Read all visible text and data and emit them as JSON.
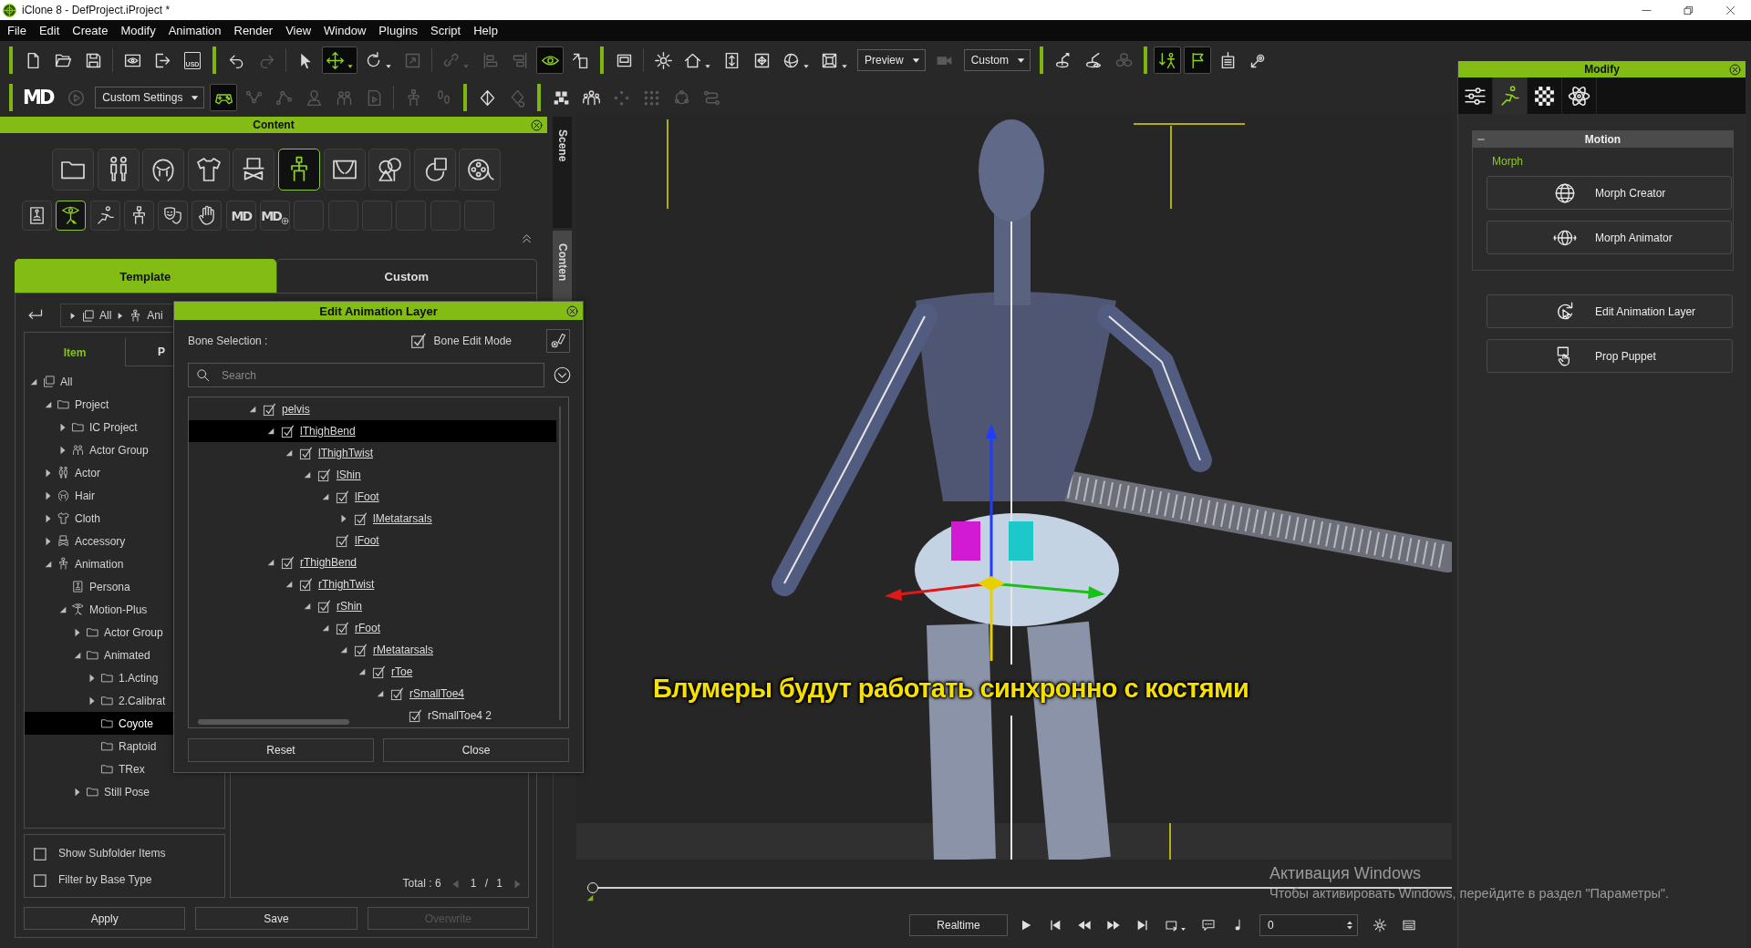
{
  "window": {
    "title": "iClone 8 - DefProject.iProject *"
  },
  "menu": [
    "File",
    "Edit",
    "Create",
    "Modify",
    "Animation",
    "Render",
    "View",
    "Window",
    "Plugins",
    "Script",
    "Help"
  ],
  "toolbar_main": [
    {
      "kind": "accent"
    },
    {
      "kind": "tool",
      "selected": false,
      "disabled": false
    },
    {
      "kind": "tool",
      "selected": false,
      "disabled": false
    },
    {
      "kind": "tool",
      "selected": false,
      "disabled": false
    },
    {
      "kind": "divider"
    },
    {
      "kind": "tool",
      "selected": false,
      "disabled": false
    },
    {
      "kind": "tool",
      "selected": false,
      "disabled": false
    },
    {
      "kind": "tool",
      "label": "USD",
      "selected": false,
      "disabled": false
    },
    {
      "kind": "accent"
    },
    {
      "kind": "tool",
      "selected": false,
      "disabled": false
    },
    {
      "kind": "tool",
      "selected": false,
      "disabled": true
    },
    {
      "kind": "divider"
    },
    {
      "kind": "tool",
      "selected": false,
      "disabled": false
    },
    {
      "kind": "split",
      "selected": true,
      "disabled": false
    },
    {
      "kind": "split",
      "selected": false,
      "disabled": false
    },
    {
      "kind": "tool",
      "selected": false,
      "disabled": true
    },
    {
      "kind": "divider"
    },
    {
      "kind": "split",
      "selected": false,
      "disabled": true
    },
    {
      "kind": "tool",
      "selected": false,
      "disabled": true
    },
    {
      "kind": "tool",
      "selected": false,
      "disabled": true
    },
    {
      "kind": "tool",
      "selected": true,
      "disabled": false
    },
    {
      "kind": "tool",
      "selected": false,
      "disabled": false
    },
    {
      "kind": "accent"
    },
    {
      "kind": "tool",
      "selected": false,
      "disabled": false
    },
    {
      "kind": "divider"
    },
    {
      "kind": "tool",
      "selected": false,
      "disabled": false
    },
    {
      "kind": "split",
      "selected": false,
      "disabled": false
    },
    {
      "kind": "tool",
      "selected": false,
      "disabled": false
    },
    {
      "kind": "tool",
      "selected": false,
      "disabled": false
    },
    {
      "kind": "split",
      "selected": false,
      "disabled": false
    },
    {
      "kind": "split",
      "selected": false,
      "disabled": false
    },
    {
      "kind": "dropdown",
      "value": "Preview"
    },
    {
      "kind": "tool",
      "selected": false,
      "disabled": true
    },
    {
      "kind": "dropdown",
      "value": "Custom"
    },
    {
      "kind": "accent"
    },
    {
      "kind": "tool",
      "selected": false,
      "disabled": false
    },
    {
      "kind": "tool",
      "selected": false,
      "disabled": false
    },
    {
      "kind": "tool",
      "selected": false,
      "disabled": true
    },
    {
      "kind": "accent"
    },
    {
      "kind": "tool",
      "selected": true,
      "disabled": false
    },
    {
      "kind": "tool",
      "selected": true,
      "disabled": false
    },
    {
      "kind": "tool",
      "selected": false,
      "disabled": false
    },
    {
      "kind": "tool",
      "selected": false,
      "disabled": false
    }
  ],
  "toolbar_secondary": [
    {
      "kind": "accent"
    },
    {
      "kind": "logo",
      "label": "MD"
    },
    {
      "kind": "tool",
      "selected": false,
      "disabled": true
    },
    {
      "kind": "dropdown",
      "value": "Custom Settings"
    },
    {
      "kind": "tool",
      "selected": true,
      "disabled": false
    },
    {
      "kind": "tool",
      "selected": false,
      "disabled": true
    },
    {
      "kind": "tool",
      "selected": false,
      "disabled": true
    },
    {
      "kind": "tool",
      "selected": false,
      "disabled": true
    },
    {
      "kind": "tool",
      "selected": false,
      "disabled": true
    },
    {
      "kind": "tool",
      "selected": false,
      "disabled": true
    },
    {
      "kind": "divider"
    },
    {
      "kind": "tool",
      "selected": false,
      "disabled": true
    },
    {
      "kind": "tool",
      "selected": false,
      "disabled": true
    },
    {
      "kind": "accent"
    },
    {
      "kind": "tool",
      "selected": false,
      "disabled": false
    },
    {
      "kind": "tool",
      "selected": false,
      "disabled": true
    },
    {
      "kind": "accent"
    },
    {
      "kind": "tool",
      "selected": false,
      "disabled": false
    },
    {
      "kind": "tool",
      "selected": false,
      "disabled": false
    },
    {
      "kind": "tool",
      "selected": false,
      "disabled": true
    },
    {
      "kind": "tool",
      "selected": false,
      "disabled": true
    },
    {
      "kind": "tool",
      "selected": false,
      "disabled": true
    },
    {
      "kind": "tool",
      "selected": false,
      "disabled": true
    }
  ],
  "content_panel": {
    "title": "Content",
    "category_buttons": [
      {
        "selected": false
      },
      {
        "selected": false
      },
      {
        "selected": false
      },
      {
        "selected": false
      },
      {
        "selected": false
      },
      {
        "selected": true
      },
      {
        "selected": false
      },
      {
        "selected": false
      },
      {
        "selected": false
      },
      {
        "selected": false
      }
    ],
    "subcategory_buttons": [
      {
        "kind": "icon",
        "selected": false
      },
      {
        "kind": "icon",
        "selected": true
      },
      {
        "kind": "icon",
        "selected": false
      },
      {
        "kind": "icon",
        "selected": false
      },
      {
        "kind": "icon",
        "selected": false
      },
      {
        "kind": "icon",
        "selected": false
      },
      {
        "kind": "logo",
        "label": "MD",
        "selected": false
      },
      {
        "kind": "logo_plus",
        "label": "MD",
        "selected": false
      },
      {
        "kind": "empty",
        "selected": false
      },
      {
        "kind": "empty",
        "selected": false
      },
      {
        "kind": "empty",
        "selected": false
      },
      {
        "kind": "empty",
        "selected": false
      },
      {
        "kind": "empty",
        "selected": false
      },
      {
        "kind": "empty",
        "selected": false
      }
    ],
    "tabs": [
      {
        "label": "Template",
        "selected": true
      },
      {
        "label": "Custom",
        "selected": false
      }
    ],
    "breadcrumb": [
      {
        "label": "All",
        "kind": "collection"
      },
      {
        "label": "Ani",
        "kind": "animation"
      }
    ],
    "tree_tabs": [
      {
        "label": "Item",
        "selected": true
      },
      {
        "label": "P",
        "selected": false
      }
    ],
    "tree": [
      {
        "label": "All",
        "kind": "collection",
        "expanded": true,
        "selected": false,
        "children": [
          {
            "label": "Project",
            "kind": "folder",
            "expanded": true,
            "selected": false,
            "children": [
              {
                "label": "IC Project",
                "kind": "folder",
                "expanded": false,
                "selected": false
              },
              {
                "label": "Actor Group",
                "kind": "group",
                "expanded": false,
                "selected": false
              }
            ]
          },
          {
            "label": "Actor",
            "kind": "actor",
            "expanded": false,
            "selected": false
          },
          {
            "label": "Hair",
            "kind": "hair",
            "expanded": false,
            "selected": false
          },
          {
            "label": "Cloth",
            "kind": "cloth",
            "expanded": false,
            "selected": false
          },
          {
            "label": "Accessory",
            "kind": "accessory",
            "expanded": false,
            "selected": false
          },
          {
            "label": "Animation",
            "kind": "animation",
            "expanded": true,
            "selected": false,
            "children": [
              {
                "label": "Persona",
                "kind": "persona",
                "selected": false
              },
              {
                "label": "Motion-Plus",
                "kind": "motion",
                "expanded": true,
                "selected": false,
                "children": [
                  {
                    "label": "Actor Group",
                    "kind": "folder",
                    "expanded": false,
                    "selected": false
                  },
                  {
                    "label": "Animated",
                    "kind": "folder",
                    "expanded": true,
                    "selected": false,
                    "children": [
                      {
                        "label": "1.Acting",
                        "kind": "folder",
                        "expanded": false,
                        "selected": false
                      },
                      {
                        "label": "2.Calibrat",
                        "kind": "folder",
                        "expanded": false,
                        "selected": false
                      },
                      {
                        "label": "Coyote",
                        "kind": "folder",
                        "selected": true
                      },
                      {
                        "label": "Raptoid",
                        "kind": "folder",
                        "selected": false
                      },
                      {
                        "label": "TRex",
                        "kind": "folder",
                        "selected": false
                      }
                    ]
                  },
                  {
                    "label": "Still Pose",
                    "kind": "folder",
                    "expanded": false,
                    "selected": false
                  }
                ]
              }
            ]
          }
        ]
      }
    ],
    "options": [
      {
        "label": "Show Subfolder Items",
        "checked": false
      },
      {
        "label": "Filter by Base Type",
        "checked": false
      }
    ],
    "total": "Total : 6",
    "page": "1 / 1",
    "buttons": [
      {
        "label": "Apply",
        "disabled": false
      },
      {
        "label": "Save",
        "disabled": false
      },
      {
        "label": "Overwrite",
        "disabled": true
      }
    ]
  },
  "side_tabs": [
    {
      "label": "Scene",
      "selected": false
    },
    {
      "label": "Conten",
      "selected": true
    }
  ],
  "viewport": {
    "caption": "Блумеры будут работать синхронно с костями"
  },
  "timeline": {
    "level": 0
  },
  "playback": {
    "mode": "Realtime",
    "frame": "0"
  },
  "modify_panel": {
    "title": "Modify",
    "tabs": [
      {
        "selected": false
      },
      {
        "selected": true
      },
      {
        "selected": false
      },
      {
        "selected": false
      }
    ],
    "section": {
      "title": "Motion",
      "expanded": true,
      "group_label": "Morph",
      "group_buttons": [
        "Morph Creator",
        "Morph Animator"
      ]
    },
    "buttons": [
      "Edit Animation Layer",
      "Prop Puppet"
    ]
  },
  "dialog": {
    "title": "Edit Animation Layer",
    "bone_selection_label": "Bone Selection :",
    "bone_edit_mode": {
      "label": "Bone Edit Mode",
      "checked": true
    },
    "search": {
      "placeholder": "Search"
    },
    "bones": [
      {
        "label": "pelvis",
        "expanded": true,
        "checked": true,
        "selected": false,
        "linked": true,
        "children": [
          {
            "label": "lThighBend",
            "expanded": true,
            "checked": true,
            "selected": true,
            "linked": true,
            "children": [
              {
                "label": "lThighTwist",
                "expanded": true,
                "checked": true,
                "selected": false,
                "linked": true,
                "children": [
                  {
                    "label": "lShin",
                    "expanded": true,
                    "checked": true,
                    "selected": false,
                    "linked": true,
                    "children": [
                      {
                        "label": "lFoot",
                        "expanded": true,
                        "checked": true,
                        "selected": false,
                        "linked": true,
                        "children": [
                          {
                            "label": "lMetatarsals",
                            "expanded": false,
                            "checked": true,
                            "selected": false,
                            "linked": true
                          }
                        ]
                      },
                      {
                        "label": "lFoot",
                        "checked": true,
                        "selected": false,
                        "linked": true
                      }
                    ]
                  }
                ]
              }
            ]
          },
          {
            "label": "rThighBend",
            "expanded": true,
            "checked": true,
            "selected": false,
            "linked": true,
            "children": [
              {
                "label": "rThighTwist",
                "expanded": true,
                "checked": true,
                "selected": false,
                "linked": true,
                "children": [
                  {
                    "label": "rShin",
                    "expanded": true,
                    "checked": true,
                    "selected": false,
                    "linked": true,
                    "children": [
                      {
                        "label": "rFoot",
                        "expanded": true,
                        "checked": true,
                        "selected": false,
                        "linked": true,
                        "children": [
                          {
                            "label": "rMetatarsals",
                            "expanded": true,
                            "checked": true,
                            "selected": false,
                            "linked": true,
                            "children": [
                              {
                                "label": "rToe",
                                "expanded": true,
                                "checked": true,
                                "selected": false,
                                "linked": true,
                                "children": [
                                  {
                                    "label": "rSmallToe4",
                                    "expanded": true,
                                    "checked": true,
                                    "selected": false,
                                    "linked": true,
                                    "children": [
                                      {
                                        "label": "rSmallToe4 2",
                                        "checked": true,
                                        "selected": false,
                                        "linked": false
                                      }
                                    ]
                                  }
                                ]
                              }
                            ]
                          }
                        ]
                      }
                    ]
                  }
                ]
              }
            ]
          }
        ]
      }
    ],
    "buttons": [
      "Reset",
      "Close"
    ]
  },
  "os_notice": {
    "title": "Активация Windows",
    "message": "Чтобы активировать Windows, перейдите в раздел \"Параметры\"."
  }
}
